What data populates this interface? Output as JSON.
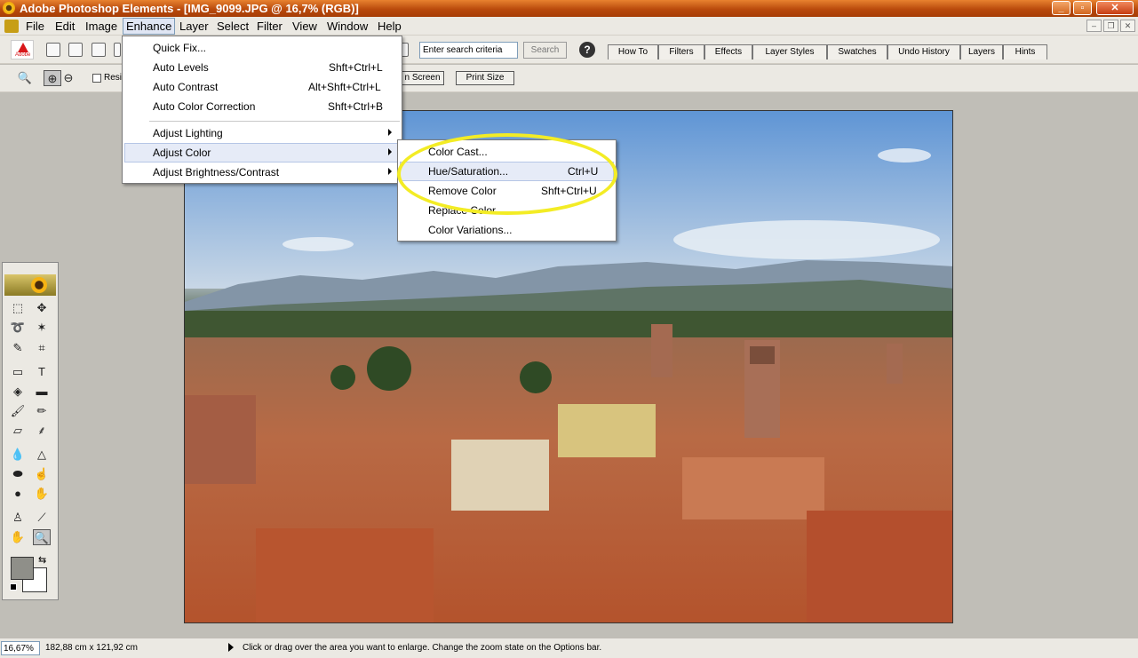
{
  "window": {
    "title": "Adobe Photoshop Elements - [IMG_9099.JPG @ 16,7% (RGB)]",
    "controls": [
      "minimize",
      "maximize",
      "close"
    ]
  },
  "menubar": {
    "items": [
      "File",
      "Edit",
      "Image",
      "Enhance",
      "Layer",
      "Select",
      "Filter",
      "View",
      "Window",
      "Help"
    ],
    "active": "Enhance"
  },
  "shortcuts": {
    "adobe_logo": "Adobe",
    "search_placeholder": "Enter search criteria",
    "search_button": "Search",
    "help": "?"
  },
  "palette_well": {
    "tabs": [
      "How To",
      "Filters",
      "Effects",
      "Layer Styles",
      "Swatches",
      "Undo History",
      "Layers",
      "Hints"
    ]
  },
  "options_bar": {
    "resize_checkbox_label": "Resi",
    "fit_on_screen": "n Screen",
    "print_size": "Print Size"
  },
  "enhance_menu": {
    "items": [
      {
        "label": "Quick Fix...",
        "shortcut": ""
      },
      {
        "label": "Auto Levels",
        "shortcut": "Shft+Ctrl+L"
      },
      {
        "label": "Auto Contrast",
        "shortcut": "Alt+Shft+Ctrl+L"
      },
      {
        "label": "Auto Color Correction",
        "shortcut": "Shft+Ctrl+B"
      },
      {
        "label": "Adjust Lighting",
        "shortcut": "",
        "submenu": true
      },
      {
        "label": "Adjust Color",
        "shortcut": "",
        "submenu": true,
        "highlighted": true
      },
      {
        "label": "Adjust Brightness/Contrast",
        "shortcut": "",
        "submenu": true
      }
    ]
  },
  "adjust_color_submenu": {
    "items": [
      {
        "label": "Color Cast...",
        "shortcut": ""
      },
      {
        "label": "Hue/Saturation...",
        "shortcut": "Ctrl+U",
        "highlighted": true
      },
      {
        "label": "Remove Color",
        "shortcut": "Shft+Ctrl+U"
      },
      {
        "label": "Replace Color...",
        "shortcut": ""
      },
      {
        "label": "Color Variations...",
        "shortcut": ""
      }
    ]
  },
  "callout_color": "#f3ec25",
  "statusbar": {
    "zoom": "16,67%",
    "document_size": "182,88 cm x 121,92 cm",
    "hint": "Click or drag over the area you want to enlarge. Change the zoom state on the Options bar."
  },
  "colors": {
    "titlebar": "#c0520f",
    "chrome": "#ebe9e3",
    "workspace": "#c0beb7",
    "menu_highlight": "#e6ebf7"
  }
}
